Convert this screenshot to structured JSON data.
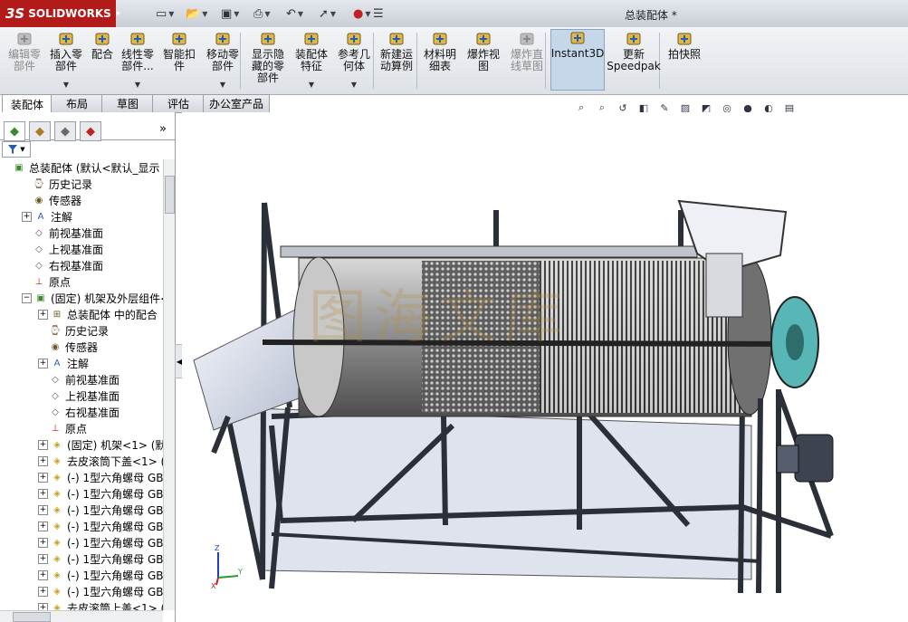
{
  "app": {
    "logo_text": "SOLIDWORKS",
    "logo_ds": "3S",
    "document_title": "总装配体 *"
  },
  "quick_access": [
    "new-doc-icon",
    "open-icon",
    "save-icon",
    "print-icon",
    "undo-icon",
    "select-icon",
    "rebuild-icon",
    "options-icon"
  ],
  "commands": [
    {
      "label": "编辑零\n部件",
      "icon": "edit-component-icon",
      "disabled": true,
      "dropdown": false
    },
    {
      "label": "插入零\n部件",
      "icon": "insert-component-icon",
      "disabled": false,
      "dropdown": true
    },
    {
      "label": "配合",
      "icon": "mate-icon",
      "disabled": false,
      "dropdown": false
    },
    {
      "label": "线性零\n部件...",
      "icon": "linear-pattern-icon",
      "disabled": false,
      "dropdown": true
    },
    {
      "label": "智能扣\n件",
      "icon": "smart-fastener-icon",
      "disabled": false,
      "dropdown": false
    },
    {
      "label": "移动零\n部件",
      "icon": "move-component-icon",
      "disabled": false,
      "dropdown": true
    },
    {
      "label": "显示隐\n藏的零\n部件",
      "icon": "show-hidden-icon",
      "disabled": false,
      "dropdown": false
    },
    {
      "label": "装配体\n特征",
      "icon": "assembly-feature-icon",
      "disabled": false,
      "dropdown": true
    },
    {
      "label": "参考几\n何体",
      "icon": "reference-geometry-icon",
      "disabled": false,
      "dropdown": true
    },
    {
      "label": "新建运\n动算例",
      "icon": "motion-study-icon",
      "disabled": false,
      "dropdown": false
    },
    {
      "label": "材料明\n细表",
      "icon": "bom-icon",
      "disabled": false,
      "dropdown": false
    },
    {
      "label": "爆炸视\n图",
      "icon": "exploded-view-icon",
      "disabled": false,
      "dropdown": false
    },
    {
      "label": "爆炸直\n线草图",
      "icon": "explode-line-icon",
      "disabled": true,
      "dropdown": false
    },
    {
      "label": "Instant3D",
      "icon": "instant3d-icon",
      "disabled": false,
      "dropdown": false,
      "active": true
    },
    {
      "label": "更新\nSpeedpak",
      "icon": "speedpak-icon",
      "disabled": false,
      "dropdown": false
    },
    {
      "label": "拍快照",
      "icon": "snapshot-icon",
      "disabled": false,
      "dropdown": false
    }
  ],
  "tabs": [
    "装配体",
    "布局",
    "草图",
    "评估",
    "办公室产品"
  ],
  "panel_tabs": [
    "feature-manager-icon",
    "property-manager-icon",
    "configuration-manager-icon",
    "display-manager-icon"
  ],
  "panel_more": "»",
  "tree": [
    {
      "text": "总装配体 (默认<默认_显示",
      "icon": "assembly-icon",
      "level": 0,
      "expand": "",
      "color": "#2a7a2a"
    },
    {
      "text": "历史记录",
      "icon": "history-icon",
      "level": 1,
      "expand": ""
    },
    {
      "text": "传感器",
      "icon": "sensor-icon",
      "level": 1,
      "expand": ""
    },
    {
      "text": "注解",
      "icon": "annotation-icon",
      "level": 1,
      "expand": "+"
    },
    {
      "text": "前视基准面",
      "icon": "plane-icon",
      "level": 1,
      "expand": ""
    },
    {
      "text": "上视基准面",
      "icon": "plane-icon",
      "level": 1,
      "expand": ""
    },
    {
      "text": "右视基准面",
      "icon": "plane-icon",
      "level": 1,
      "expand": ""
    },
    {
      "text": "原点",
      "icon": "origin-icon",
      "level": 1,
      "expand": ""
    },
    {
      "text": "(固定) 机架及外层组件<1",
      "icon": "subassembly-icon",
      "level": 1,
      "expand": "−"
    },
    {
      "text": "总装配体 中的配合",
      "icon": "mates-folder-icon",
      "level": 2,
      "expand": "+"
    },
    {
      "text": "历史记录",
      "icon": "history-icon",
      "level": 2,
      "expand": ""
    },
    {
      "text": "传感器",
      "icon": "sensor-icon",
      "level": 2,
      "expand": ""
    },
    {
      "text": "注解",
      "icon": "annotation-icon",
      "level": 2,
      "expand": "+"
    },
    {
      "text": "前视基准面",
      "icon": "plane-icon",
      "level": 2,
      "expand": ""
    },
    {
      "text": "上视基准面",
      "icon": "plane-icon",
      "level": 2,
      "expand": ""
    },
    {
      "text": "右视基准面",
      "icon": "plane-icon",
      "level": 2,
      "expand": ""
    },
    {
      "text": "原点",
      "icon": "origin-icon",
      "level": 2,
      "expand": ""
    },
    {
      "text": "(固定) 机架<1> (默认",
      "icon": "part-icon",
      "level": 2,
      "expand": "+"
    },
    {
      "text": "去皮滚筒下盖<1> (默",
      "icon": "part-icon",
      "level": 2,
      "expand": "+"
    },
    {
      "text": "(-) 1型六角螺母 GB_T",
      "icon": "part-icon",
      "level": 2,
      "expand": "+"
    },
    {
      "text": "(-) 1型六角螺母 GB_T",
      "icon": "part-icon",
      "level": 2,
      "expand": "+"
    },
    {
      "text": "(-) 1型六角螺母 GB_T",
      "icon": "part-icon",
      "level": 2,
      "expand": "+"
    },
    {
      "text": "(-) 1型六角螺母 GB_T",
      "icon": "part-icon",
      "level": 2,
      "expand": "+"
    },
    {
      "text": "(-) 1型六角螺母 GB_T",
      "icon": "part-icon",
      "level": 2,
      "expand": "+"
    },
    {
      "text": "(-) 1型六角螺母 GB_T",
      "icon": "part-icon",
      "level": 2,
      "expand": "+"
    },
    {
      "text": "(-) 1型六角螺母 GB_T",
      "icon": "part-icon",
      "level": 2,
      "expand": "+"
    },
    {
      "text": "(-) 1型六角螺母 GB_T",
      "icon": "part-icon",
      "level": 2,
      "expand": "+"
    },
    {
      "text": "去皮滚筒上盖<1> (",
      "icon": "part-icon",
      "level": 2,
      "expand": "+"
    }
  ],
  "viewport": {
    "watermark": "图海文库",
    "hud_icons": [
      "zoom-to-fit-icon",
      "zoom-area-icon",
      "previous-view-icon",
      "section-view-icon",
      "dynamic-annotation-icon",
      "view-orientation-icon",
      "display-style-icon",
      "hide-show-items-icon",
      "edit-appearance-icon",
      "apply-scene-icon",
      "view-settings-icon"
    ],
    "triad": {
      "x": "X",
      "y": "Y",
      "z": "Z"
    }
  },
  "colors": {
    "logo_bg": "#b31b1b",
    "active_cmd": "#c6d7ea",
    "frame": "#2b2f38",
    "drum": "#9c9c9c",
    "motor": "#3d4350"
  }
}
